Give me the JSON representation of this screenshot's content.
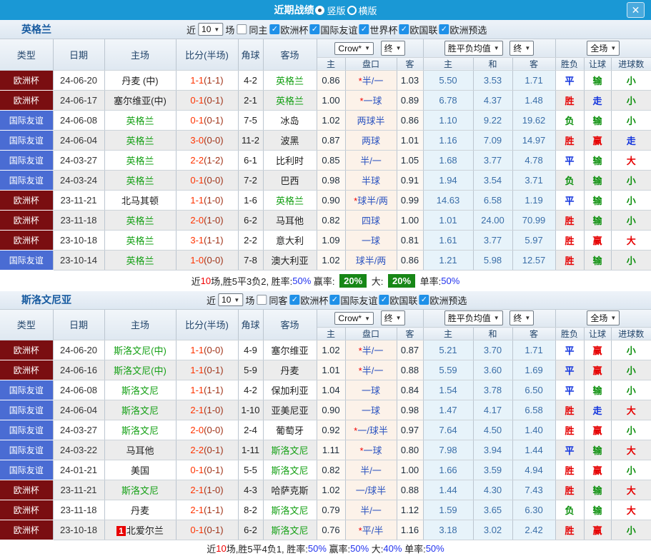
{
  "titlebar": {
    "title": "近期战绩",
    "radio_vertical": "竖版",
    "radio_horizontal": "横版",
    "close_label": "✕"
  },
  "labels": {
    "near": "近",
    "games": "场"
  },
  "table_header": {
    "col_type": "类型",
    "col_date": "日期",
    "col_home": "主场",
    "col_score": "比分(半场)",
    "col_corner": "角球",
    "col_away": "客场",
    "dd_provider": "Crow*",
    "dd_final1": "终",
    "dd_avg": "胜平负均值",
    "dd_final2": "终",
    "dd_fulltime": "全场",
    "sub_home_odds": "主",
    "sub_handicap": "盘口",
    "sub_away_odds": "客",
    "sub_home_avg": "主",
    "sub_draw_avg": "和",
    "sub_away_avg": "客",
    "col_result": "胜负",
    "col_handicap_result": "让球",
    "col_goals": "进球数"
  },
  "sections": [
    {
      "team": "英格兰",
      "filter": {
        "count": "10",
        "same_label": "同主",
        "leagues": [
          "欧洲杯",
          "国际友谊",
          "世界杯",
          "欧国联",
          "欧洲预选"
        ]
      },
      "rows": [
        {
          "type": "欧洲杯",
          "tc": "cup",
          "date": "24-06-20",
          "home": "丹麦 (中)",
          "hg": false,
          "score": "1-1",
          "half": "(1-1)",
          "corner": "4-2",
          "away": "英格兰",
          "ag": true,
          "oh": "0.86",
          "hc": "*半/一",
          "oa": "1.03",
          "ah": "5.50",
          "ad": "3.53",
          "aa": "1.71",
          "r": "平",
          "rc": "blue",
          "l": "输",
          "lc": "green",
          "g": "小",
          "gc": "green"
        },
        {
          "type": "欧洲杯",
          "tc": "cup",
          "date": "24-06-17",
          "home": "塞尔维亚(中)",
          "hg": false,
          "score": "0-1",
          "half": "(0-1)",
          "corner": "2-1",
          "away": "英格兰",
          "ag": true,
          "oh": "1.00",
          "hc": "*一球",
          "oa": "0.89",
          "ah": "6.78",
          "ad": "4.37",
          "aa": "1.48",
          "r": "胜",
          "rc": "red",
          "l": "走",
          "lc": "blue",
          "g": "小",
          "gc": "green"
        },
        {
          "type": "国际友谊",
          "tc": "friendly",
          "date": "24-06-08",
          "home": "英格兰",
          "hg": true,
          "score": "0-1",
          "half": "(0-1)",
          "corner": "7-5",
          "away": "冰岛",
          "ag": false,
          "oh": "1.02",
          "hc": "两球半",
          "oa": "0.86",
          "ah": "1.10",
          "ad": "9.22",
          "aa": "19.62",
          "r": "负",
          "rc": "green",
          "l": "输",
          "lc": "green",
          "g": "小",
          "gc": "green"
        },
        {
          "type": "国际友谊",
          "tc": "friendly",
          "date": "24-06-04",
          "home": "英格兰",
          "hg": true,
          "score": "3-0",
          "half": "(0-0)",
          "corner": "11-2",
          "away": "波黑",
          "ag": false,
          "oh": "0.87",
          "hc": "两球",
          "oa": "1.01",
          "ah": "1.16",
          "ad": "7.09",
          "aa": "14.97",
          "r": "胜",
          "rc": "red",
          "l": "赢",
          "lc": "red",
          "g": "走",
          "gc": "blue"
        },
        {
          "type": "国际友谊",
          "tc": "friendly",
          "date": "24-03-27",
          "home": "英格兰",
          "hg": true,
          "score": "2-2",
          "half": "(1-2)",
          "corner": "6-1",
          "away": "比利时",
          "ag": false,
          "oh": "0.85",
          "hc": "半/一",
          "oa": "1.05",
          "ah": "1.68",
          "ad": "3.77",
          "aa": "4.78",
          "r": "平",
          "rc": "blue",
          "l": "输",
          "lc": "green",
          "g": "大",
          "gc": "red"
        },
        {
          "type": "国际友谊",
          "tc": "friendly",
          "date": "24-03-24",
          "home": "英格兰",
          "hg": true,
          "score": "0-1",
          "half": "(0-0)",
          "corner": "7-2",
          "away": "巴西",
          "ag": false,
          "oh": "0.98",
          "hc": "半球",
          "oa": "0.91",
          "ah": "1.94",
          "ad": "3.54",
          "aa": "3.71",
          "r": "负",
          "rc": "green",
          "l": "输",
          "lc": "green",
          "g": "小",
          "gc": "green"
        },
        {
          "type": "欧洲杯",
          "tc": "cup",
          "date": "23-11-21",
          "home": "北马其顿",
          "hg": false,
          "score": "1-1",
          "half": "(1-0)",
          "corner": "1-6",
          "away": "英格兰",
          "ag": true,
          "oh": "0.90",
          "hc": "*球半/两",
          "oa": "0.99",
          "ah": "14.63",
          "ad": "6.58",
          "aa": "1.19",
          "r": "平",
          "rc": "blue",
          "l": "输",
          "lc": "green",
          "g": "小",
          "gc": "green"
        },
        {
          "type": "欧洲杯",
          "tc": "cup",
          "date": "23-11-18",
          "home": "英格兰",
          "hg": true,
          "score": "2-0",
          "half": "(1-0)",
          "corner": "6-2",
          "away": "马耳他",
          "ag": false,
          "oh": "0.82",
          "hc": "四球",
          "oa": "1.00",
          "ah": "1.01",
          "ad": "24.00",
          "aa": "70.99",
          "r": "胜",
          "rc": "red",
          "l": "输",
          "lc": "green",
          "g": "小",
          "gc": "green"
        },
        {
          "type": "欧洲杯",
          "tc": "cup",
          "date": "23-10-18",
          "home": "英格兰",
          "hg": true,
          "score": "3-1",
          "half": "(1-1)",
          "corner": "2-2",
          "away": "意大利",
          "ag": false,
          "oh": "1.09",
          "hc": "一球",
          "oa": "0.81",
          "ah": "1.61",
          "ad": "3.77",
          "aa": "5.97",
          "r": "胜",
          "rc": "red",
          "l": "赢",
          "lc": "red",
          "g": "大",
          "gc": "red"
        },
        {
          "type": "国际友谊",
          "tc": "friendly",
          "date": "23-10-14",
          "home": "英格兰",
          "hg": true,
          "score": "1-0",
          "half": "(0-0)",
          "corner": "7-8",
          "away": "澳大利亚",
          "ag": false,
          "oh": "1.02",
          "hc": "球半/两",
          "oa": "0.86",
          "ah": "1.21",
          "ad": "5.98",
          "aa": "12.57",
          "r": "胜",
          "rc": "red",
          "l": "输",
          "lc": "green",
          "g": "小",
          "gc": "green"
        }
      ],
      "summary": [
        {
          "t": "近"
        },
        {
          "t": "10",
          "c": "red"
        },
        {
          "t": "场,胜5平3负2, 胜率:"
        },
        {
          "t": "50%",
          "c": "blue"
        },
        {
          "t": " 赢率: "
        },
        {
          "t": "20%",
          "c": "badge"
        },
        {
          "t": " 大: "
        },
        {
          "t": "20%",
          "c": "badge"
        },
        {
          "t": " 单率:"
        },
        {
          "t": "50%",
          "c": "blue"
        }
      ]
    },
    {
      "team": "斯洛文尼亚",
      "filter": {
        "count": "10",
        "same_label": "同客",
        "leagues": [
          "欧洲杯",
          "国际友谊",
          "欧国联",
          "欧洲预选"
        ]
      },
      "rows": [
        {
          "type": "欧洲杯",
          "tc": "cup",
          "date": "24-06-20",
          "home": "斯洛文尼(中)",
          "hg": true,
          "score": "1-1",
          "half": "(0-0)",
          "corner": "4-9",
          "away": "塞尔维亚",
          "ag": false,
          "oh": "1.02",
          "hc": "*半/一",
          "oa": "0.87",
          "ah": "5.21",
          "ad": "3.70",
          "aa": "1.71",
          "r": "平",
          "rc": "blue",
          "l": "赢",
          "lc": "red",
          "g": "小",
          "gc": "green"
        },
        {
          "type": "欧洲杯",
          "tc": "cup",
          "date": "24-06-16",
          "home": "斯洛文尼(中)",
          "hg": true,
          "score": "1-1",
          "half": "(0-1)",
          "corner": "5-9",
          "away": "丹麦",
          "ag": false,
          "oh": "1.01",
          "hc": "*半/一",
          "oa": "0.88",
          "ah": "5.59",
          "ad": "3.60",
          "aa": "1.69",
          "r": "平",
          "rc": "blue",
          "l": "赢",
          "lc": "red",
          "g": "小",
          "gc": "green"
        },
        {
          "type": "国际友谊",
          "tc": "friendly",
          "date": "24-06-08",
          "home": "斯洛文尼",
          "hg": true,
          "score": "1-1",
          "half": "(1-1)",
          "corner": "4-2",
          "away": "保加利亚",
          "ag": false,
          "oh": "1.04",
          "hc": "一球",
          "oa": "0.84",
          "ah": "1.54",
          "ad": "3.78",
          "aa": "6.50",
          "r": "平",
          "rc": "blue",
          "l": "输",
          "lc": "green",
          "g": "小",
          "gc": "green"
        },
        {
          "type": "国际友谊",
          "tc": "friendly",
          "date": "24-06-04",
          "home": "斯洛文尼",
          "hg": true,
          "score": "2-1",
          "half": "(1-0)",
          "corner": "1-10",
          "away": "亚美尼亚",
          "ag": false,
          "oh": "0.90",
          "hc": "一球",
          "oa": "0.98",
          "ah": "1.47",
          "ad": "4.17",
          "aa": "6.58",
          "r": "胜",
          "rc": "red",
          "l": "走",
          "lc": "blue",
          "g": "大",
          "gc": "red"
        },
        {
          "type": "国际友谊",
          "tc": "friendly",
          "date": "24-03-27",
          "home": "斯洛文尼",
          "hg": true,
          "score": "2-0",
          "half": "(0-0)",
          "corner": "2-4",
          "away": "葡萄牙",
          "ag": false,
          "oh": "0.92",
          "hc": "*一/球半",
          "oa": "0.97",
          "ah": "7.64",
          "ad": "4.50",
          "aa": "1.40",
          "r": "胜",
          "rc": "red",
          "l": "赢",
          "lc": "red",
          "g": "小",
          "gc": "green"
        },
        {
          "type": "国际友谊",
          "tc": "friendly",
          "date": "24-03-22",
          "home": "马耳他",
          "hg": false,
          "score": "2-2",
          "half": "(0-1)",
          "corner": "1-11",
          "away": "斯洛文尼",
          "ag": true,
          "oh": "1.11",
          "hc": "*一球",
          "oa": "0.80",
          "ah": "7.98",
          "ad": "3.94",
          "aa": "1.44",
          "r": "平",
          "rc": "blue",
          "l": "输",
          "lc": "green",
          "g": "大",
          "gc": "red"
        },
        {
          "type": "国际友谊",
          "tc": "friendly",
          "date": "24-01-21",
          "home": "美国",
          "hg": false,
          "score": "0-1",
          "half": "(0-1)",
          "corner": "5-5",
          "away": "斯洛文尼",
          "ag": true,
          "oh": "0.82",
          "hc": "半/一",
          "oa": "1.00",
          "ah": "1.66",
          "ad": "3.59",
          "aa": "4.94",
          "r": "胜",
          "rc": "red",
          "l": "赢",
          "lc": "red",
          "g": "小",
          "gc": "green"
        },
        {
          "type": "欧洲杯",
          "tc": "cup",
          "date": "23-11-21",
          "home": "斯洛文尼",
          "hg": true,
          "score": "2-1",
          "half": "(1-0)",
          "corner": "4-3",
          "away": "哈萨克斯",
          "ag": false,
          "oh": "1.02",
          "hc": "一/球半",
          "oa": "0.88",
          "ah": "1.44",
          "ad": "4.30",
          "aa": "7.43",
          "r": "胜",
          "rc": "red",
          "l": "输",
          "lc": "green",
          "g": "大",
          "gc": "red"
        },
        {
          "type": "欧洲杯",
          "tc": "cup",
          "date": "23-11-18",
          "home": "丹麦",
          "hg": false,
          "score": "2-1",
          "half": "(1-1)",
          "corner": "8-2",
          "away": "斯洛文尼",
          "ag": true,
          "oh": "0.79",
          "hc": "半/一",
          "oa": "1.12",
          "ah": "1.59",
          "ad": "3.65",
          "aa": "6.30",
          "r": "负",
          "rc": "green",
          "l": "输",
          "lc": "green",
          "g": "大",
          "gc": "red"
        },
        {
          "type": "欧洲杯",
          "tc": "cup",
          "date": "23-10-18",
          "home": "北爱尔兰",
          "hg": false,
          "hb": "1",
          "score": "0-1",
          "half": "(0-1)",
          "corner": "6-2",
          "away": "斯洛文尼",
          "ag": true,
          "oh": "0.76",
          "hc": "*平/半",
          "oa": "1.16",
          "ah": "3.18",
          "ad": "3.02",
          "aa": "2.42",
          "r": "胜",
          "rc": "red",
          "l": "赢",
          "lc": "red",
          "g": "小",
          "gc": "green"
        }
      ],
      "summary": [
        {
          "t": "近"
        },
        {
          "t": "10",
          "c": "red"
        },
        {
          "t": "场,胜5平4负1, 胜率:"
        },
        {
          "t": "50%",
          "c": "blue"
        },
        {
          "t": " 赢率:"
        },
        {
          "t": "50%",
          "c": "blue"
        },
        {
          "t": " 大:"
        },
        {
          "t": "40%",
          "c": "blue"
        },
        {
          "t": " 单率:"
        },
        {
          "t": "50%",
          "c": "blue"
        }
      ]
    }
  ]
}
